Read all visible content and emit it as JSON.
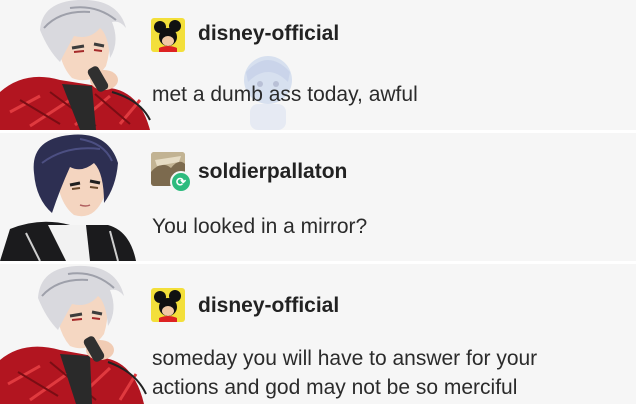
{
  "posts": [
    {
      "username": "disney-official",
      "avatar_icon": "mickey-mouse-icon",
      "text": "met a dumb ass today, awful"
    },
    {
      "username": "soldierpallaton",
      "avatar_icon": "photo-avatar",
      "reblog_icon": "reblog-icon",
      "text": "You looked in a mirror?"
    },
    {
      "username": "disney-official",
      "avatar_icon": "mickey-mouse-icon",
      "text_lines": [
        "someday you will have to answer for your",
        "actions and god may not be so merciful"
      ]
    }
  ],
  "colors": {
    "panel_bg": "#f6f6f6",
    "reblog_green": "#2dbb7e",
    "mickey_avatar_bg": "#f3df3a"
  }
}
